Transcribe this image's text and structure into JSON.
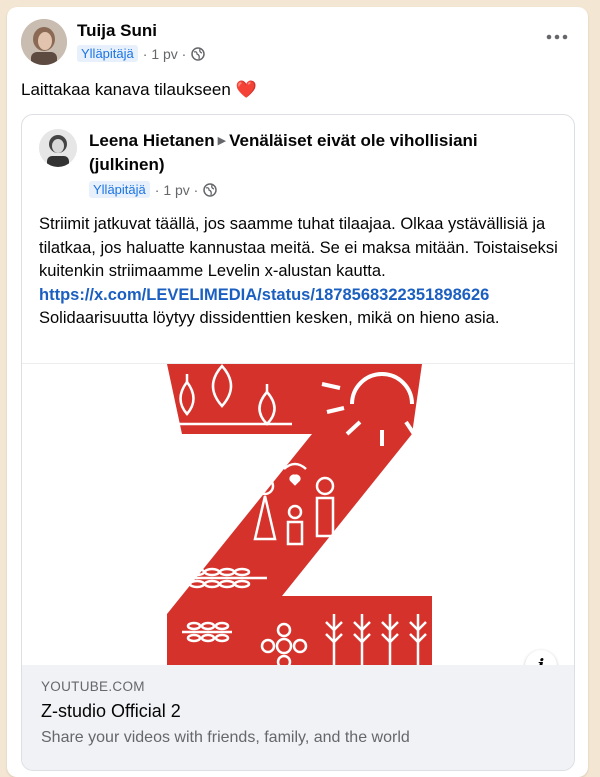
{
  "post": {
    "author": "Tuija Suni",
    "badge": "Ylläpitäjä",
    "time": "· 1 pv ·",
    "text": "Laittakaa kanava tilaukseen",
    "heart": "❤️",
    "more_icon": "more-horizontal-icon"
  },
  "shared": {
    "author": "Leena Hietanen",
    "arrow": "▶",
    "group": "Venäläiset eivät ole vihollisiani (julkinen)",
    "badge": "Ylläpitäjä",
    "time": "· 1 pv ·",
    "body_text": "Striimit jatkuvat täällä, jos saamme tuhat tilaajaa.  Olkaa ystävällisiä ja tilatkaa, jos haluatte kannustaa meitä. Se ei maksa mitään. Toistaiseksi kuitenkin striimaamme Levelin x-alustan kautta.",
    "link_text": "https://x.com/LEVELIMEDIA/status/1878568322351898626",
    "body_text2": "Solidaarisuutta löytyy dissidenttien kesken, mikä on hieno asia."
  },
  "link_preview": {
    "domain": "YOUTUBE.COM",
    "title": "Z-studio Official 2",
    "description": "Share your videos with friends, family, and the world",
    "info_label": "i"
  },
  "colors": {
    "accent_red": "#d5322c",
    "link_blue": "#1b5fc1",
    "badge_blue": "#1b74e4"
  }
}
